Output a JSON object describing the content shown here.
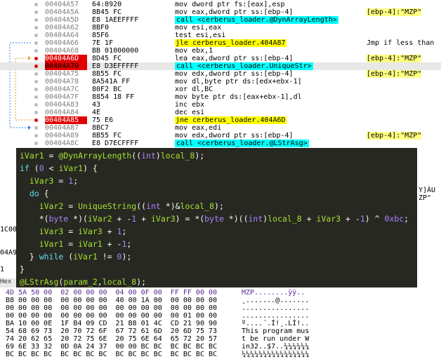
{
  "disasm": {
    "rows": [
      {
        "addr": "00404A57",
        "bytes": "64:8920",
        "ins": "mov dword ptr fs:[eax],esp",
        "cmt": "",
        "kind": "normal"
      },
      {
        "addr": "00404A5A",
        "bytes": "8B45 FC",
        "ins": "mov eax,dword ptr ss:[ebp-4]",
        "cmt": "[ebp-4]:\"MZP\"",
        "kind": "normal"
      },
      {
        "addr": "00404A5D",
        "bytes": "E8 1AEEFFFF",
        "ins": "call <cerberus_loader.@DynArrayLength>",
        "cmt": "",
        "kind": "call"
      },
      {
        "addr": "00404A62",
        "bytes": "8BF0",
        "ins": "mov esi,eax",
        "cmt": "",
        "kind": "normal"
      },
      {
        "addr": "00404A64",
        "bytes": "85F6",
        "ins": "test esi,esi",
        "cmt": "",
        "kind": "normal"
      },
      {
        "addr": "00404A66",
        "bytes": "7E 1F",
        "ins": "jle cerberus_loader.404A87",
        "cmt": "Jmp if less than",
        "kind": "jmp"
      },
      {
        "addr": "00404A68",
        "bytes": "BB 01000000",
        "ins": "mov ebx,1",
        "cmt": "",
        "kind": "normal"
      },
      {
        "addr": "00404A6D",
        "bytes": "8D45 FC",
        "ins": "lea eax,dword ptr ss:[ebp-4]",
        "cmt": "[ebp-4]:\"MZP\"",
        "kind": "normal"
      },
      {
        "addr": "00404A70",
        "bytes": "E8 D3EFFFFF",
        "ins": "call <cerberus_loader.UniqueStr>",
        "cmt": "",
        "kind": "call"
      },
      {
        "addr": "00404A75",
        "bytes": "8B55 FC",
        "ins": "mov edx,dword ptr ss:[ebp-4]",
        "cmt": "[ebp-4]:\"MZP\"",
        "kind": "normal"
      },
      {
        "addr": "00404A78",
        "bytes": "8A541A FF",
        "ins": "mov dl,byte ptr ds:[edx+ebx-1]",
        "cmt": "",
        "kind": "normal"
      },
      {
        "addr": "00404A7C",
        "bytes": "80F2 BC",
        "ins": "xor dl,BC",
        "cmt": "",
        "kind": "normal"
      },
      {
        "addr": "00404A7F",
        "bytes": "8854 18 FF",
        "ins": "mov byte ptr ds:[eax+ebx-1],dl",
        "cmt": "",
        "kind": "normal"
      },
      {
        "addr": "00404A83",
        "bytes": "43",
        "ins": "inc ebx",
        "cmt": "",
        "kind": "normal"
      },
      {
        "addr": "00404A84",
        "bytes": "4E",
        "ins": "dec esi",
        "cmt": "",
        "kind": "normal"
      },
      {
        "addr": "00404A85",
        "bytes": "75 E6",
        "ins": "jne cerberus_loader.404A6D",
        "cmt": "",
        "kind": "jmp"
      },
      {
        "addr": "00404A87",
        "bytes": "8BC7",
        "ins": "mov eax,edi",
        "cmt": "",
        "kind": "normal"
      },
      {
        "addr": "00404A89",
        "bytes": "8B55 FC",
        "ins": "mov edx,dword ptr ss:[ebp-4]",
        "cmt": "[ebp-4]:\"MZP\"",
        "kind": "normal"
      },
      {
        "addr": "00404A8C",
        "bytes": "E8 D7ECFFFF",
        "ins": "call <cerberus_loader.@LStrAsg>",
        "cmt": "",
        "kind": "call"
      }
    ]
  },
  "decompiler": {
    "lines": [
      "iVar1 = @DynArrayLength((int)local_8);",
      "if (0 < iVar1) {",
      "  iVar3 = 1;",
      "  do {",
      "    iVar2 = UniqueString((int *)&local_8);",
      "    *(byte *)(iVar2 + -1 + iVar3) = *(byte *)((int)local_8 + iVar3 + -1) ^ 0xbc;",
      "    iVar3 = iVar3 + 1;",
      "    iVar1 = iVar1 + -1;",
      "  } while (iVar1 != 0);",
      "}",
      "@LStrAsg(param_2,local_8);"
    ]
  },
  "side": {
    "left_label_1": "1C00",
    "left_label_2": "04A9",
    "left_label_3": "1",
    "tab_label": "Hex",
    "right_label_1": "Y]ÀU",
    "right_label_2": "ZP\""
  },
  "hex": {
    "rows": [
      {
        "hex": "4D 5A 50 00  02 00 00 00  04 00 0F 00  FF FF 00 00",
        "ascii": "MZP........ÿÿ.."
      },
      {
        "hex": "B8 00 00 00  00 00 00 00  40 00 1A 00  00 00 00 00",
        "ascii": "¸.......@......."
      },
      {
        "hex": "00 00 00 00  00 00 00 00  00 00 00 00  00 00 00 00",
        "ascii": "................"
      },
      {
        "hex": "00 00 00 00  00 00 00 00  00 00 00 00  00 01 00 00",
        "ascii": "................"
      },
      {
        "hex": "BA 10 00 0E  1F B4 09 CD  21 B8 01 4C  CD 21 90 90",
        "ascii": "º....´.Í!¸.LÍ!.."
      },
      {
        "hex": "54 68 69 73  20 70 72 6F  67 72 61 6D  20 6D 75 73",
        "ascii": "This program mus"
      },
      {
        "hex": "74 20 62 65  20 72 75 6E  20 75 6E 64  65 72 20 57",
        "ascii": "t be run under W"
      },
      {
        "hex": "69 6E 33 32  0D 0A 24 37  00 00 BC BC  BC BC BC BC",
        "ascii": "in32..$7..¼¼¼¼¼¼"
      },
      {
        "hex": "BC BC BC BC  BC BC BC BC  BC BC BC BC  BC BC BC BC",
        "ascii": "¼¼¼¼¼¼¼¼¼¼¼¼¼¼¼¼"
      }
    ]
  }
}
